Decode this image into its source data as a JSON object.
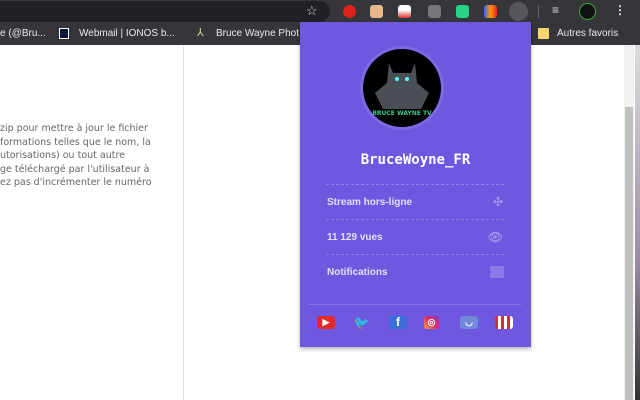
{
  "bookmarks": {
    "items": [
      "e (@Bru...",
      "Webmail | IONOS b...",
      "Bruce Wayne Phot"
    ],
    "other": "Autres favoris"
  },
  "page": {
    "lines": [
      "zip pour mettre à jour le fichier",
      "formations telles que le nom, la",
      "utorisations) ou tout autre",
      "ge téléchargé par l'utilisateur à",
      "ez pas d'incrémenter le numéro"
    ]
  },
  "popup": {
    "avatar_text": "BRUCE WAYNE TV",
    "username": "BruceWoyne_FR",
    "status": "Stream hors-ligne",
    "views": "11 129 vues",
    "notifications": "Notifications",
    "accent": "#6f57e0"
  },
  "social": [
    "youtube",
    "twitter",
    "facebook",
    "instagram",
    "discord",
    "shop"
  ]
}
